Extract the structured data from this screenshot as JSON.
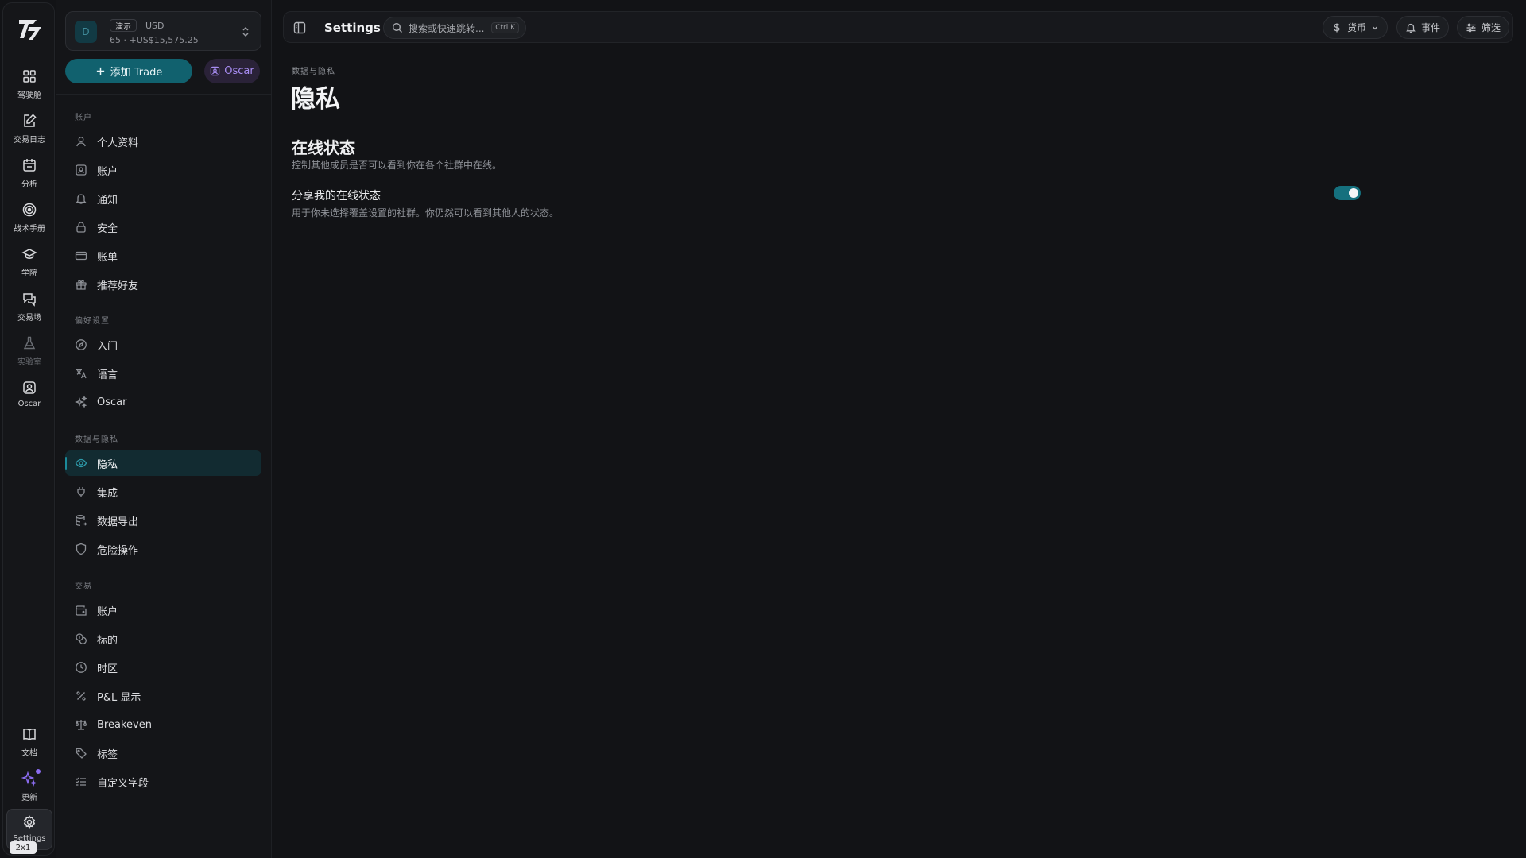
{
  "rail": {
    "items": [
      {
        "label": "驾驶舱",
        "icon": "dashboard-icon"
      },
      {
        "label": "交易日志",
        "icon": "journal-icon"
      },
      {
        "label": "分析",
        "icon": "calendar-icon"
      },
      {
        "label": "战术手册",
        "icon": "target-icon"
      },
      {
        "label": "学院",
        "icon": "graduation-cap-icon"
      },
      {
        "label": "交易场",
        "icon": "chat-icon"
      },
      {
        "label": "实验室",
        "icon": "flask-icon"
      },
      {
        "label": "Oscar",
        "icon": "oscar-icon"
      }
    ],
    "bottom": [
      {
        "label": "文档",
        "icon": "book-icon"
      },
      {
        "label": "更新",
        "icon": "sparkle-icon"
      },
      {
        "label": "Settings",
        "icon": "gear-icon"
      }
    ],
    "size_badge": "2x1"
  },
  "account": {
    "avatar": "D",
    "tag": "演示",
    "currency": "USD",
    "balance": "65 · +US$15,575.25"
  },
  "buttons": {
    "add_trade": "添加 Trade",
    "oscar": "Oscar"
  },
  "sidebar": {
    "sections": [
      {
        "title": "账户",
        "items": [
          {
            "label": "个人资料",
            "icon": "user-icon"
          },
          {
            "label": "账户",
            "icon": "id-card-icon"
          },
          {
            "label": "通知",
            "icon": "bell-icon"
          },
          {
            "label": "安全",
            "icon": "lock-icon"
          },
          {
            "label": "账单",
            "icon": "credit-card-icon"
          },
          {
            "label": "推荐好友",
            "icon": "gift-icon"
          }
        ]
      },
      {
        "title": "偏好设置",
        "items": [
          {
            "label": "入门",
            "icon": "compass-icon"
          },
          {
            "label": "语言",
            "icon": "translate-icon"
          },
          {
            "label": "Oscar",
            "icon": "sparkles-icon"
          }
        ]
      },
      {
        "title": "数据与隐私",
        "items": [
          {
            "label": "隐私",
            "icon": "eye-icon"
          },
          {
            "label": "集成",
            "icon": "plug-icon"
          },
          {
            "label": "数据导出",
            "icon": "database-export-icon"
          },
          {
            "label": "危险操作",
            "icon": "shield-icon"
          }
        ]
      },
      {
        "title": "交易",
        "items": [
          {
            "label": "账户",
            "icon": "wallet-icon"
          },
          {
            "label": "标的",
            "icon": "coins-icon"
          },
          {
            "label": "时区",
            "icon": "clock-icon"
          },
          {
            "label": "P&L 显示",
            "icon": "percent-icon"
          },
          {
            "label": "Breakeven",
            "icon": "scale-icon"
          },
          {
            "label": "标签",
            "icon": "tag-icon"
          },
          {
            "label": "自定义字段",
            "icon": "list-check-icon"
          }
        ]
      }
    ],
    "active": "隐私"
  },
  "topbar": {
    "title": "Settings",
    "search_placeholder": "搜索或快速跳转...",
    "search_shortcut": "Ctrl K",
    "currency_label": "货币",
    "events_label": "事件",
    "filter_label": "筛选"
  },
  "main": {
    "breadcrumb": "数据与隐私",
    "title": "隐私",
    "section_title": "在线状态",
    "section_desc": "控制其他成员是否可以看到你在各个社群中在线。",
    "setting_title": "分享我的在线状态",
    "setting_desc": "用于你未选择覆盖设置的社群。你仍然可以看到其他人的状态。",
    "setting_enabled": true
  },
  "colors": {
    "accent": "#11616e",
    "oscar_purple": "#a88df3",
    "background": "#121316"
  }
}
